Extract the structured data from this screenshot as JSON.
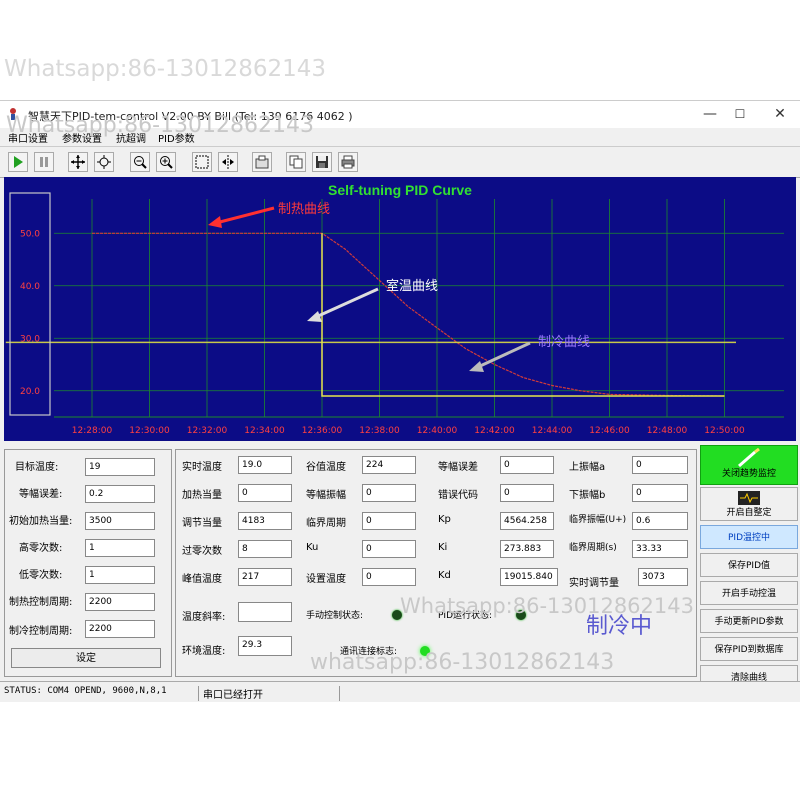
{
  "watermarks": [
    "Whatsapp:86-13012862143",
    "Whatsapp:86-13012862143",
    "Whatsapp:86-13012862143",
    "whatsapp:86-13012862143"
  ],
  "window": {
    "title": "智慧天下PID-tem-control V2.00    BY Bill (Tel: 139 6176 4062 )"
  },
  "menu": [
    "串口设置",
    "参数设置",
    "抗超调",
    "PID参数"
  ],
  "toolbar": [
    "play-icon",
    "pause-icon",
    "move-icon",
    "zoom-fit-icon",
    "zoom-out-icon",
    "zoom-in-icon",
    "select-icon",
    "split-icon",
    "export-icon",
    "copy-icon",
    "save-icon",
    "print-icon"
  ],
  "chart_data": {
    "type": "line",
    "title": "Self-tuning PID Curve",
    "x_ticks": [
      "12:28:00",
      "12:30:00",
      "12:32:00",
      "12:34:00",
      "12:36:00",
      "12:38:00",
      "12:40:00",
      "12:42:00",
      "12:44:00",
      "12:46:00",
      "12:48:00",
      "12:50:00"
    ],
    "y_ticks": [
      "20.0",
      "30.0",
      "40.0",
      "50.0"
    ],
    "ylim": [
      15,
      55
    ],
    "annotations": [
      "制热曲线",
      "室温曲线",
      "制冷曲线"
    ],
    "series": [
      {
        "color": "#d03a3a",
        "points": [
          [
            0,
            50
          ],
          [
            4,
            50
          ],
          [
            4.4,
            47
          ],
          [
            5,
            41
          ],
          [
            5.5,
            36
          ],
          [
            6,
            32
          ],
          [
            6.5,
            28
          ],
          [
            7,
            25
          ],
          [
            7.5,
            22.5
          ],
          [
            8,
            21
          ],
          [
            8.5,
            20
          ],
          [
            9,
            19.3
          ],
          [
            10,
            19.1
          ],
          [
            11,
            19
          ]
        ]
      },
      {
        "color": "#c8c84a",
        "points": [
          [
            -1.5,
            29.2
          ],
          [
            11.2,
            29.2
          ]
        ]
      },
      {
        "color": "#e6e64a",
        "points": [
          [
            4,
            50
          ],
          [
            4,
            19
          ],
          [
            11,
            19
          ]
        ]
      }
    ],
    "grid": true,
    "colors": {
      "background": "#0c0c86",
      "grid": "#1c8a2c",
      "ticks": "#ff4040",
      "title": "#32e032"
    }
  },
  "left": {
    "rows": [
      {
        "label": "目标温度:",
        "value": "19"
      },
      {
        "label": "等幅误差:",
        "value": "0.2"
      },
      {
        "label": "初始加热当量:",
        "value": "3500"
      },
      {
        "label": "高零次数:",
        "value": "1"
      },
      {
        "label": "低零次数:",
        "value": "1"
      },
      {
        "label": "制热控制周期:",
        "value": "2200"
      },
      {
        "label": "制冷控制周期:",
        "value": "2200"
      }
    ],
    "set_button": "设定"
  },
  "middle": {
    "col1": [
      {
        "label": "实时温度",
        "value": "19.0"
      },
      {
        "label": "加热当量",
        "value": "0"
      },
      {
        "label": "调节当量",
        "value": "4183"
      },
      {
        "label": "过零次数",
        "value": "8"
      },
      {
        "label": "峰值温度",
        "value": "217"
      }
    ],
    "col2": [
      {
        "label": "谷值温度",
        "value": "224"
      },
      {
        "label": "等幅振幅",
        "value": "0"
      },
      {
        "label": "临界周期",
        "value": "0"
      },
      {
        "label": "Ku",
        "value": "0"
      },
      {
        "label": "设置温度",
        "value": "0"
      }
    ],
    "col3": [
      {
        "label": "等幅误差",
        "value": "0"
      },
      {
        "label": "错误代码",
        "value": "0"
      },
      {
        "label": "Kp",
        "value": "4564.258"
      },
      {
        "label": "Ki",
        "value": "273.883"
      },
      {
        "label": "Kd",
        "value": "19015.840"
      }
    ],
    "col4": [
      {
        "label": "上振幅a",
        "value": "0"
      },
      {
        "label": "下振幅b",
        "value": "0"
      },
      {
        "label": "临界振幅(U+)",
        "value": "0.6"
      },
      {
        "label": "临界周期(s)",
        "value": "33.33"
      },
      {
        "label": "实时调节量",
        "value": "3073"
      }
    ],
    "slope_label": "温度斜率:",
    "slope_value": "",
    "ambient_label": "环境温度:",
    "ambient_value": "29.3",
    "manual_label": "手动控制状态:",
    "pid_run_label": "PID运行状态:",
    "comm_label": "通讯连接标志:",
    "mode_text": "制冷中"
  },
  "right": {
    "buttons": [
      "关闭趋势监控",
      "开启自整定",
      "PID温控中",
      "保存PID值",
      "开启手动控温",
      "手动更新PID参数",
      "保存PID到数据库",
      "清除曲线"
    ]
  },
  "status": {
    "text": "STATUS: COM4 OPEND, 9600,N,8,1",
    "port": "串口已经打开"
  }
}
